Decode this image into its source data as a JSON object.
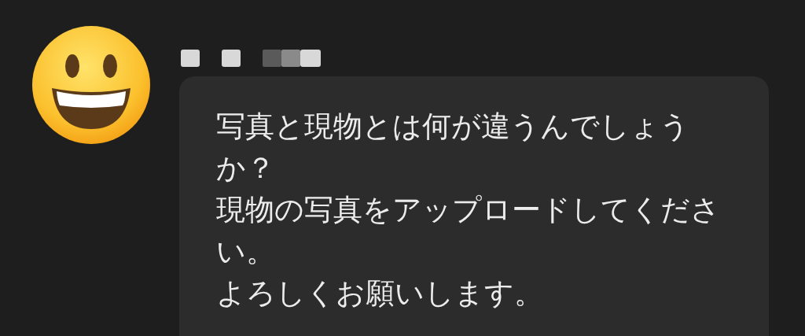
{
  "message": {
    "paragraphs": [
      "写真と現物とは何が違うんでしょうか？",
      "現物の写真をアップロードしてください。",
      "よろしくお願いします。"
    ]
  }
}
